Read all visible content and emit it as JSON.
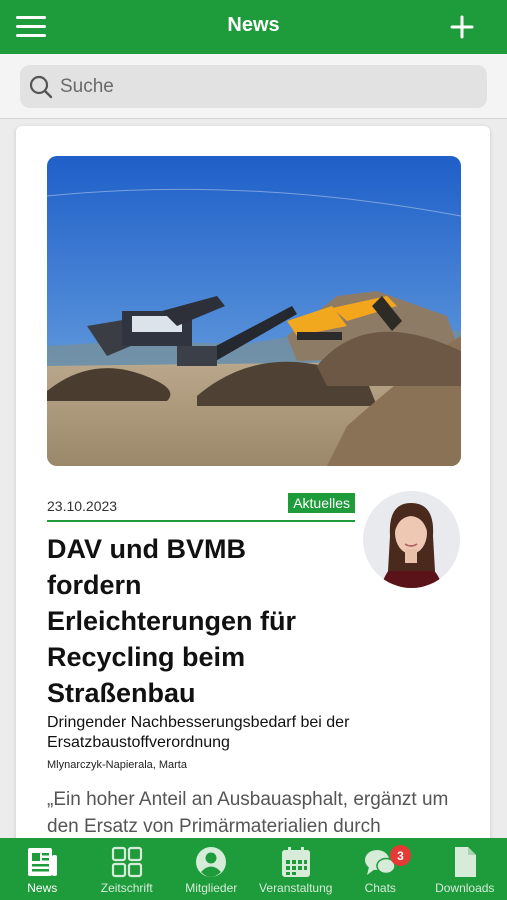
{
  "header": {
    "title": "News",
    "menu_icon": "hamburger-menu-icon",
    "add_icon": "plus-icon"
  },
  "search": {
    "placeholder": "Suche",
    "icon": "search-icon"
  },
  "article": {
    "date": "23.10.2023",
    "category": "Aktuelles",
    "headline": "DAV und BVMB fordern Erleichterungen für Recycling beim Straßenbau",
    "subtitle": "Dringender Nachbesserungsbedarf bei der Ersatzbaustoffverordnung",
    "author": "Mlynarczyk-Napierala, Marta",
    "excerpt": "„Ein hoher Anteil an Ausbauasphalt, ergänzt um den Ersatz von Primärmaterialien durch"
  },
  "tabs": [
    {
      "label": "News",
      "icon": "newspaper-icon",
      "active": true
    },
    {
      "label": "Zeitschrift",
      "icon": "grid-icon"
    },
    {
      "label": "Mitglieder",
      "icon": "user-circle-icon"
    },
    {
      "label": "Veranstaltung",
      "icon": "calendar-icon"
    },
    {
      "label": "Chats",
      "icon": "chat-bubbles-icon",
      "badge": "3"
    },
    {
      "label": "Downloads",
      "icon": "document-icon"
    }
  ],
  "colors": {
    "brand_green": "#1e9b3a",
    "badge_red": "#e53935"
  }
}
